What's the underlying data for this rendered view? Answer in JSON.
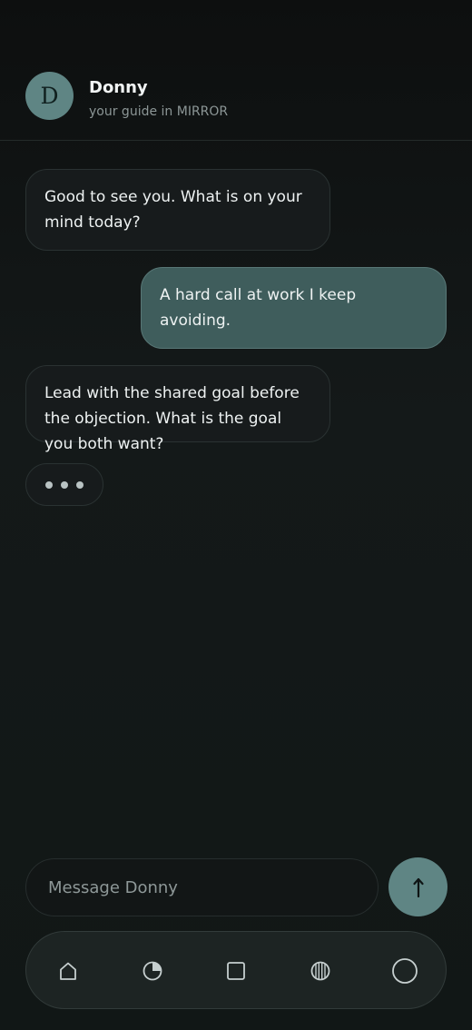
{
  "header": {
    "avatar_initial": "D",
    "name": "Donny",
    "subtitle": "your guide in MIRROR"
  },
  "messages": [
    {
      "role": "bot",
      "text": "Good to see you. What is on your mind today?"
    },
    {
      "role": "user",
      "text": "A hard call at work I keep avoiding."
    },
    {
      "role": "bot",
      "text": "Lead with the shared goal before the objection. What is the goal you both want?"
    }
  ],
  "typing_indicator": true,
  "composer": {
    "placeholder": "Message Donny",
    "value": "",
    "send_icon": "arrow-up-icon"
  },
  "nav": {
    "items": [
      {
        "icon": "home-icon"
      },
      {
        "icon": "pie-chart-icon"
      },
      {
        "icon": "square-icon"
      },
      {
        "icon": "striped-circle-icon"
      },
      {
        "icon": "circle-icon"
      }
    ]
  },
  "colors": {
    "accent": "#5f8584",
    "user_bubble": "#3f5d5c",
    "bot_bubble": "#171b1c",
    "background": "#121717"
  }
}
